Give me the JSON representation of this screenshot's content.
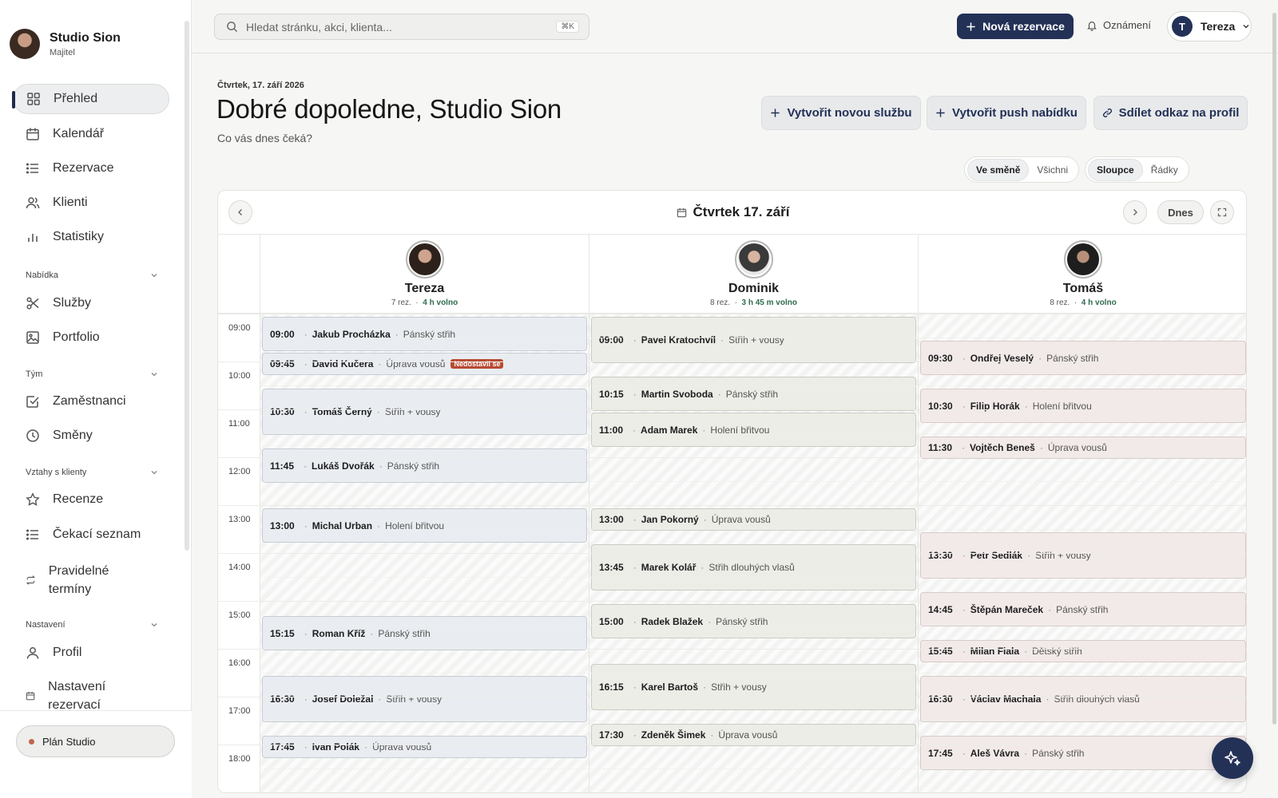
{
  "sidebar": {
    "studio_name": "Studio Sion",
    "studio_role": "Majitel",
    "main_items": [
      {
        "label": "Přehled",
        "icon": "grid-icon"
      },
      {
        "label": "Kalendář",
        "icon": "calendar-icon"
      },
      {
        "label": "Rezervace",
        "icon": "list-icon"
      },
      {
        "label": "Klienti",
        "icon": "users-icon"
      },
      {
        "label": "Statistiky",
        "icon": "bar-chart-icon"
      }
    ],
    "sections": [
      {
        "title": "Nabídka",
        "items": [
          {
            "label": "Služby",
            "icon": "scissors-icon"
          },
          {
            "label": "Portfolio",
            "icon": "image-icon"
          }
        ]
      },
      {
        "title": "Tým",
        "items": [
          {
            "label": "Zaměstnanci",
            "icon": "check-square-icon"
          },
          {
            "label": "Směny",
            "icon": "clock-icon"
          }
        ]
      },
      {
        "title": "Vztahy s klienty",
        "items": [
          {
            "label": "Recenze",
            "icon": "star-icon"
          },
          {
            "label": "Čekací seznam",
            "icon": "list-icon"
          },
          {
            "label": "Pravidelné termíny",
            "icon": "repeat-icon"
          }
        ]
      },
      {
        "title": "Nastavení",
        "items": [
          {
            "label": "Profil",
            "icon": "user-icon"
          },
          {
            "label": "Nastavení rezervací",
            "icon": "calendar-icon"
          }
        ]
      }
    ],
    "plan_label": "Plán Studio"
  },
  "topbar": {
    "search_placeholder": "Hledat stránku, akci, klienta...",
    "search_shortcut": "⌘K",
    "new_reservation": "Nová rezervace",
    "notifications": "Oznámení",
    "user_initial": "T",
    "user_name": "Tereza"
  },
  "header": {
    "date": "Čtvrtek, 17. září 2026",
    "greeting": "Dobré dopoledne, Studio Sion",
    "subtitle": "Co vás dnes čeká?",
    "actions": [
      "Vytvořit novou službu",
      "Vytvořit push nabídku",
      "Sdílet odkaz na profil"
    ]
  },
  "toggles": {
    "shift": [
      "Ve směně",
      "Všichni"
    ],
    "shift_selected": "Ve směně",
    "layout": [
      "Sloupce",
      "Řádky"
    ],
    "layout_selected": "Sloupce"
  },
  "calendar": {
    "title": "Čtvrtek 17. září",
    "today_button": "Dnes",
    "hours": [
      "09:00",
      "10:00",
      "11:00",
      "12:00",
      "13:00",
      "14:00",
      "15:00",
      "16:00",
      "17:00",
      "18:00"
    ],
    "staff": [
      {
        "name": "Tereza",
        "reservations": "7 rez.",
        "free": "4 h volno",
        "appointments": [
          {
            "time": "09:00",
            "client": "Jakub Procházka",
            "service": "Pánský střih",
            "start": "09:00",
            "end": "09:45"
          },
          {
            "time": "09:45",
            "client": "David Kučera",
            "service": "Úprava vousů",
            "start": "09:45",
            "end": "10:15",
            "badge": "Nedostavil se"
          },
          {
            "time": "10:30",
            "client": "Tomáš Černý",
            "service": "Střih + vousy",
            "start": "10:30",
            "end": "11:30"
          },
          {
            "time": "11:45",
            "client": "Lukáš Dvořák",
            "service": "Pánský střih",
            "start": "11:45",
            "end": "12:30"
          },
          {
            "time": "13:00",
            "client": "Michal Urban",
            "service": "Holení břitvou",
            "start": "13:00",
            "end": "13:45"
          },
          {
            "time": "15:15",
            "client": "Roman Kříž",
            "service": "Pánský střih",
            "start": "15:15",
            "end": "16:00"
          },
          {
            "time": "16:30",
            "client": "Josef Doležal",
            "service": "Střih + vousy",
            "start": "16:30",
            "end": "17:30"
          },
          {
            "time": "17:45",
            "client": "Ivan Polák",
            "service": "Úprava vousů",
            "start": "17:45",
            "end": "18:15"
          }
        ]
      },
      {
        "name": "Dominik",
        "reservations": "8 rez.",
        "free": "3 h 45 m volno",
        "appointments": [
          {
            "time": "09:00",
            "client": "Pavel Kratochvíl",
            "service": "Střih + vousy",
            "start": "09:00",
            "end": "10:00"
          },
          {
            "time": "10:15",
            "client": "Martin Svoboda",
            "service": "Pánský střih",
            "start": "10:15",
            "end": "11:00"
          },
          {
            "time": "11:00",
            "client": "Adam Marek",
            "service": "Holení břitvou",
            "start": "11:00",
            "end": "11:45"
          },
          {
            "time": "13:00",
            "client": "Jan Pokorný",
            "service": "Úprava vousů",
            "start": "13:00",
            "end": "13:30"
          },
          {
            "time": "13:45",
            "client": "Marek Kolář",
            "service": "Střih dlouhých vlasů",
            "start": "13:45",
            "end": "14:45"
          },
          {
            "time": "15:00",
            "client": "Radek Blažek",
            "service": "Pánský střih",
            "start": "15:00",
            "end": "15:45"
          },
          {
            "time": "16:15",
            "client": "Karel Bartoš",
            "service": "Střih + vousy",
            "start": "16:15",
            "end": "17:15"
          },
          {
            "time": "17:30",
            "client": "Zdeněk Šimek",
            "service": "Úprava vousů",
            "start": "17:30",
            "end": "18:00"
          }
        ]
      },
      {
        "name": "Tomáš",
        "reservations": "8 rez.",
        "free": "4 h volno",
        "appointments": [
          {
            "time": "09:30",
            "client": "Ondřej Veselý",
            "service": "Pánský střih",
            "start": "09:30",
            "end": "10:15"
          },
          {
            "time": "10:30",
            "client": "Filip Horák",
            "service": "Holení břitvou",
            "start": "10:30",
            "end": "11:15"
          },
          {
            "time": "11:30",
            "client": "Vojtěch Beneš",
            "service": "Úprava vousů",
            "start": "11:30",
            "end": "12:00"
          },
          {
            "time": "13:30",
            "client": "Petr Sedlák",
            "service": "Střih + vousy",
            "start": "13:30",
            "end": "14:30"
          },
          {
            "time": "14:45",
            "client": "Štěpán Mareček",
            "service": "Pánský střih",
            "start": "14:45",
            "end": "15:30"
          },
          {
            "time": "15:45",
            "client": "Milan Fiala",
            "service": "Dětský střih",
            "start": "15:45",
            "end": "16:15"
          },
          {
            "time": "16:30",
            "client": "Václav Machala",
            "service": "Střih dlouhých vlasů",
            "start": "16:30",
            "end": "17:30"
          },
          {
            "time": "17:45",
            "client": "Aleš Vávra",
            "service": "Pánský střih",
            "start": "17:45",
            "end": "18:30"
          }
        ]
      }
    ]
  },
  "colors": {
    "accent": "#233157",
    "badge": "#b84a32",
    "free_text": "#2f6b4f",
    "col1_appt": "#e9edf1",
    "col2_appt": "#ebede6",
    "col3_appt": "#f2eae8"
  }
}
